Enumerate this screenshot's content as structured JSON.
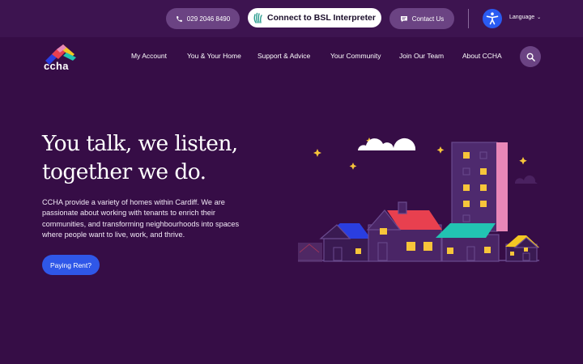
{
  "topbar": {
    "phone": "029 2046 8490",
    "bsl": "Connect to BSL Interpreter",
    "contact": "Contact Us",
    "language": "Language"
  },
  "logo": {
    "text": "ccha"
  },
  "nav": {
    "items": [
      {
        "label": "My Account"
      },
      {
        "label": "You & Your Home"
      },
      {
        "label": "Support & Advice"
      },
      {
        "label": "Your Community"
      },
      {
        "label": "Join Our Team"
      },
      {
        "label": "About CCHA"
      }
    ]
  },
  "hero": {
    "title_line1": "You talk, we listen,",
    "title_line2": "together we do.",
    "text": "CCHA provide a variety of homes within Cardiff. We are passionate about working with tenants to enrich their communities, and transforming neighbourhoods into spaces where people want to live, work, and thrive.",
    "cta": "Paying Rent?"
  },
  "colors": {
    "background": "#360d46",
    "topbar": "#3d1450",
    "pill": "#6b4383",
    "accent_blue": "#2f57e8",
    "roof_red": "#e8404f",
    "roof_teal": "#22c3b2",
    "roof_blue": "#2a3ee0",
    "roof_yellow": "#f3c623",
    "window_yellow": "#f7c53a",
    "tower_pink": "#e887b8"
  },
  "icons": {
    "phone": "phone-icon",
    "bsl": "sign-language-hand-icon",
    "contact": "chat-bubble-icon",
    "access": "accessibility-person-icon",
    "language_chevron": "chevron-down-icon",
    "search": "search-icon"
  }
}
